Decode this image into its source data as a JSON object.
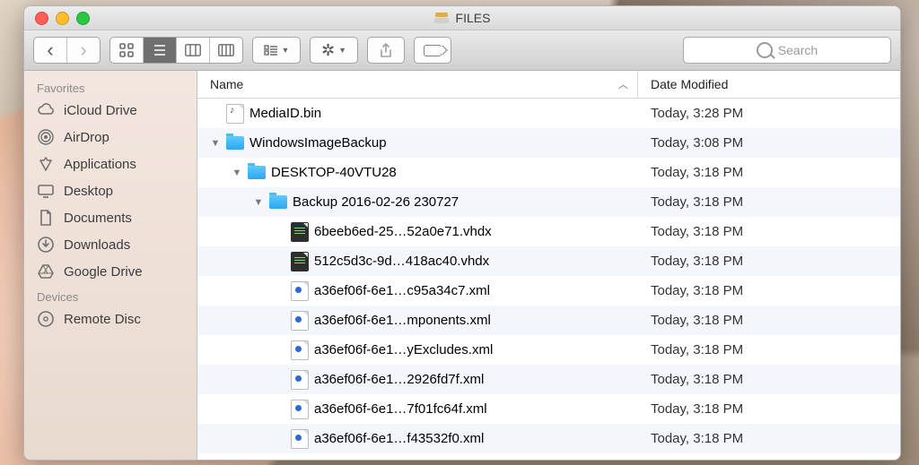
{
  "window": {
    "title": "FILES"
  },
  "toolbar": {
    "nav": {
      "back": "‹",
      "forward": "›"
    },
    "views": {
      "icons": "icon",
      "list": "list",
      "columns": "columns",
      "gallery": "gallery"
    },
    "search_placeholder": "Search"
  },
  "sidebar": {
    "groups": [
      {
        "header": "Favorites",
        "items": [
          {
            "icon": "cloud",
            "label": "iCloud Drive"
          },
          {
            "icon": "airdrop",
            "label": "AirDrop"
          },
          {
            "icon": "apps",
            "label": "Applications"
          },
          {
            "icon": "desktop",
            "label": "Desktop"
          },
          {
            "icon": "docs",
            "label": "Documents"
          },
          {
            "icon": "downloads",
            "label": "Downloads"
          },
          {
            "icon": "gdrive",
            "label": "Google Drive"
          }
        ]
      },
      {
        "header": "Devices",
        "items": [
          {
            "icon": "disc",
            "label": "Remote Disc"
          }
        ]
      }
    ]
  },
  "columns": {
    "name": "Name",
    "date": "Date Modified"
  },
  "files": [
    {
      "indent": 0,
      "disclosure": "",
      "icon": "bin",
      "name": "MediaID.bin",
      "date": "Today, 3:28 PM"
    },
    {
      "indent": 0,
      "disclosure": "▼",
      "icon": "folder",
      "name": "WindowsImageBackup",
      "date": "Today, 3:08 PM"
    },
    {
      "indent": 1,
      "disclosure": "▼",
      "icon": "folder",
      "name": "DESKTOP-40VTU28",
      "date": "Today, 3:18 PM"
    },
    {
      "indent": 2,
      "disclosure": "▼",
      "icon": "folder",
      "name": "Backup 2016-02-26 230727",
      "date": "Today, 3:18 PM"
    },
    {
      "indent": 3,
      "disclosure": "",
      "icon": "vhdx",
      "name": "6beeb6ed-25…52a0e71.vhdx",
      "date": "Today, 3:18 PM"
    },
    {
      "indent": 3,
      "disclosure": "",
      "icon": "vhdx",
      "name": "512c5d3c-9d…418ac40.vhdx",
      "date": "Today, 3:18 PM"
    },
    {
      "indent": 3,
      "disclosure": "",
      "icon": "xml",
      "name": "a36ef06f-6e1…c95a34c7.xml",
      "date": "Today, 3:18 PM"
    },
    {
      "indent": 3,
      "disclosure": "",
      "icon": "xml",
      "name": "a36ef06f-6e1…mponents.xml",
      "date": "Today, 3:18 PM"
    },
    {
      "indent": 3,
      "disclosure": "",
      "icon": "xml",
      "name": "a36ef06f-6e1…yExcludes.xml",
      "date": "Today, 3:18 PM"
    },
    {
      "indent": 3,
      "disclosure": "",
      "icon": "xml",
      "name": "a36ef06f-6e1…2926fd7f.xml",
      "date": "Today, 3:18 PM"
    },
    {
      "indent": 3,
      "disclosure": "",
      "icon": "xml",
      "name": "a36ef06f-6e1…7f01fc64f.xml",
      "date": "Today, 3:18 PM"
    },
    {
      "indent": 3,
      "disclosure": "",
      "icon": "xml",
      "name": "a36ef06f-6e1…f43532f0.xml",
      "date": "Today, 3:18 PM"
    }
  ]
}
